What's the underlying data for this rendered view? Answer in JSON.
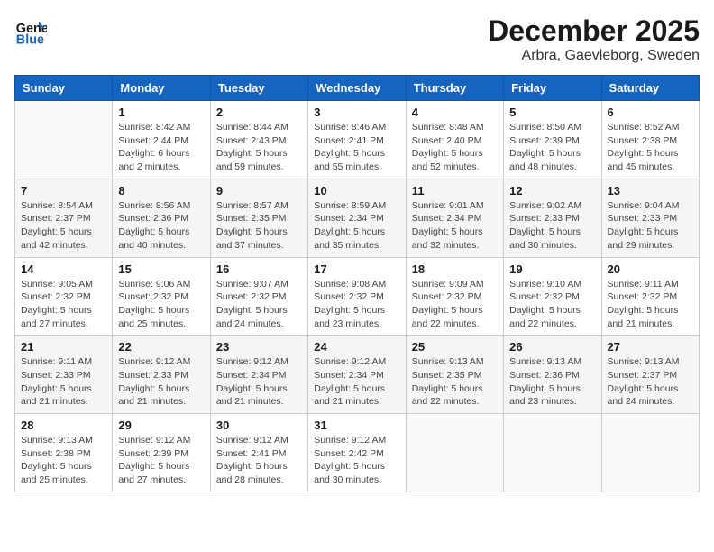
{
  "header": {
    "logo_line1": "General",
    "logo_line2": "Blue",
    "month": "December 2025",
    "location": "Arbra, Gaevleborg, Sweden"
  },
  "weekdays": [
    "Sunday",
    "Monday",
    "Tuesday",
    "Wednesday",
    "Thursday",
    "Friday",
    "Saturday"
  ],
  "weeks": [
    [
      {
        "day": "",
        "sunrise": "",
        "sunset": "",
        "daylight": ""
      },
      {
        "day": "1",
        "sunrise": "Sunrise: 8:42 AM",
        "sunset": "Sunset: 2:44 PM",
        "daylight": "Daylight: 6 hours and 2 minutes."
      },
      {
        "day": "2",
        "sunrise": "Sunrise: 8:44 AM",
        "sunset": "Sunset: 2:43 PM",
        "daylight": "Daylight: 5 hours and 59 minutes."
      },
      {
        "day": "3",
        "sunrise": "Sunrise: 8:46 AM",
        "sunset": "Sunset: 2:41 PM",
        "daylight": "Daylight: 5 hours and 55 minutes."
      },
      {
        "day": "4",
        "sunrise": "Sunrise: 8:48 AM",
        "sunset": "Sunset: 2:40 PM",
        "daylight": "Daylight: 5 hours and 52 minutes."
      },
      {
        "day": "5",
        "sunrise": "Sunrise: 8:50 AM",
        "sunset": "Sunset: 2:39 PM",
        "daylight": "Daylight: 5 hours and 48 minutes."
      },
      {
        "day": "6",
        "sunrise": "Sunrise: 8:52 AM",
        "sunset": "Sunset: 2:38 PM",
        "daylight": "Daylight: 5 hours and 45 minutes."
      }
    ],
    [
      {
        "day": "7",
        "sunrise": "Sunrise: 8:54 AM",
        "sunset": "Sunset: 2:37 PM",
        "daylight": "Daylight: 5 hours and 42 minutes."
      },
      {
        "day": "8",
        "sunrise": "Sunrise: 8:56 AM",
        "sunset": "Sunset: 2:36 PM",
        "daylight": "Daylight: 5 hours and 40 minutes."
      },
      {
        "day": "9",
        "sunrise": "Sunrise: 8:57 AM",
        "sunset": "Sunset: 2:35 PM",
        "daylight": "Daylight: 5 hours and 37 minutes."
      },
      {
        "day": "10",
        "sunrise": "Sunrise: 8:59 AM",
        "sunset": "Sunset: 2:34 PM",
        "daylight": "Daylight: 5 hours and 35 minutes."
      },
      {
        "day": "11",
        "sunrise": "Sunrise: 9:01 AM",
        "sunset": "Sunset: 2:34 PM",
        "daylight": "Daylight: 5 hours and 32 minutes."
      },
      {
        "day": "12",
        "sunrise": "Sunrise: 9:02 AM",
        "sunset": "Sunset: 2:33 PM",
        "daylight": "Daylight: 5 hours and 30 minutes."
      },
      {
        "day": "13",
        "sunrise": "Sunrise: 9:04 AM",
        "sunset": "Sunset: 2:33 PM",
        "daylight": "Daylight: 5 hours and 29 minutes."
      }
    ],
    [
      {
        "day": "14",
        "sunrise": "Sunrise: 9:05 AM",
        "sunset": "Sunset: 2:32 PM",
        "daylight": "Daylight: 5 hours and 27 minutes."
      },
      {
        "day": "15",
        "sunrise": "Sunrise: 9:06 AM",
        "sunset": "Sunset: 2:32 PM",
        "daylight": "Daylight: 5 hours and 25 minutes."
      },
      {
        "day": "16",
        "sunrise": "Sunrise: 9:07 AM",
        "sunset": "Sunset: 2:32 PM",
        "daylight": "Daylight: 5 hours and 24 minutes."
      },
      {
        "day": "17",
        "sunrise": "Sunrise: 9:08 AM",
        "sunset": "Sunset: 2:32 PM",
        "daylight": "Daylight: 5 hours and 23 minutes."
      },
      {
        "day": "18",
        "sunrise": "Sunrise: 9:09 AM",
        "sunset": "Sunset: 2:32 PM",
        "daylight": "Daylight: 5 hours and 22 minutes."
      },
      {
        "day": "19",
        "sunrise": "Sunrise: 9:10 AM",
        "sunset": "Sunset: 2:32 PM",
        "daylight": "Daylight: 5 hours and 22 minutes."
      },
      {
        "day": "20",
        "sunrise": "Sunrise: 9:11 AM",
        "sunset": "Sunset: 2:32 PM",
        "daylight": "Daylight: 5 hours and 21 minutes."
      }
    ],
    [
      {
        "day": "21",
        "sunrise": "Sunrise: 9:11 AM",
        "sunset": "Sunset: 2:33 PM",
        "daylight": "Daylight: 5 hours and 21 minutes."
      },
      {
        "day": "22",
        "sunrise": "Sunrise: 9:12 AM",
        "sunset": "Sunset: 2:33 PM",
        "daylight": "Daylight: 5 hours and 21 minutes."
      },
      {
        "day": "23",
        "sunrise": "Sunrise: 9:12 AM",
        "sunset": "Sunset: 2:34 PM",
        "daylight": "Daylight: 5 hours and 21 minutes."
      },
      {
        "day": "24",
        "sunrise": "Sunrise: 9:12 AM",
        "sunset": "Sunset: 2:34 PM",
        "daylight": "Daylight: 5 hours and 21 minutes."
      },
      {
        "day": "25",
        "sunrise": "Sunrise: 9:13 AM",
        "sunset": "Sunset: 2:35 PM",
        "daylight": "Daylight: 5 hours and 22 minutes."
      },
      {
        "day": "26",
        "sunrise": "Sunrise: 9:13 AM",
        "sunset": "Sunset: 2:36 PM",
        "daylight": "Daylight: 5 hours and 23 minutes."
      },
      {
        "day": "27",
        "sunrise": "Sunrise: 9:13 AM",
        "sunset": "Sunset: 2:37 PM",
        "daylight": "Daylight: 5 hours and 24 minutes."
      }
    ],
    [
      {
        "day": "28",
        "sunrise": "Sunrise: 9:13 AM",
        "sunset": "Sunset: 2:38 PM",
        "daylight": "Daylight: 5 hours and 25 minutes."
      },
      {
        "day": "29",
        "sunrise": "Sunrise: 9:12 AM",
        "sunset": "Sunset: 2:39 PM",
        "daylight": "Daylight: 5 hours and 27 minutes."
      },
      {
        "day": "30",
        "sunrise": "Sunrise: 9:12 AM",
        "sunset": "Sunset: 2:41 PM",
        "daylight": "Daylight: 5 hours and 28 minutes."
      },
      {
        "day": "31",
        "sunrise": "Sunrise: 9:12 AM",
        "sunset": "Sunset: 2:42 PM",
        "daylight": "Daylight: 5 hours and 30 minutes."
      },
      {
        "day": "",
        "sunrise": "",
        "sunset": "",
        "daylight": ""
      },
      {
        "day": "",
        "sunrise": "",
        "sunset": "",
        "daylight": ""
      },
      {
        "day": "",
        "sunrise": "",
        "sunset": "",
        "daylight": ""
      }
    ]
  ]
}
